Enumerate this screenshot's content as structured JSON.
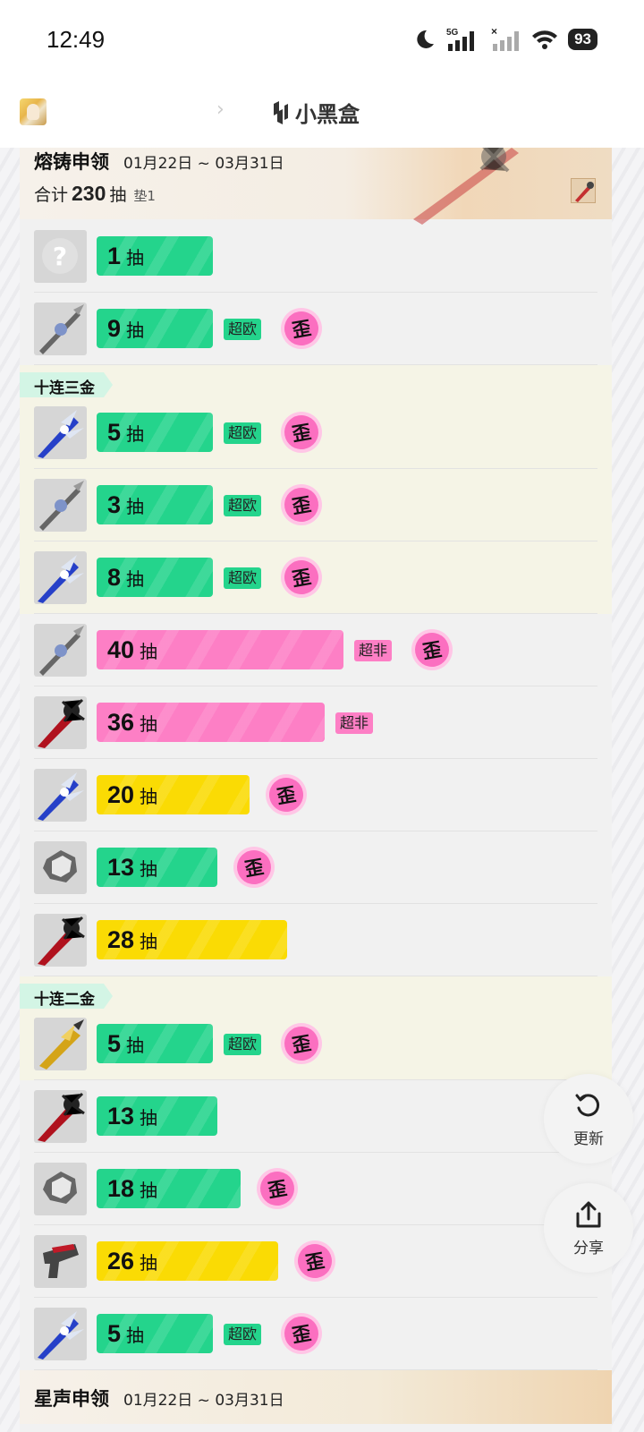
{
  "status_bar": {
    "time": "12:49",
    "battery": "93",
    "network": "5G"
  },
  "header": {
    "brand": "小黑盒"
  },
  "pool": {
    "title": "熔铸申领",
    "date_range": "01月22日 ~ 03月31日",
    "total_prefix": "合计",
    "total_value": "230",
    "total_unit": "抽",
    "pad": "垫1"
  },
  "unit": "抽",
  "badges": {
    "super_lucky": "超欧",
    "super_unlucky": "超非",
    "off_banner": "歪"
  },
  "groups": {
    "ten_three": "十连三金",
    "ten_two": "十连二金"
  },
  "rows": [
    {
      "pulls": "1",
      "color": "green",
      "badge": "",
      "off": false,
      "item": "unknown"
    },
    {
      "pulls": "9",
      "color": "green",
      "badge": "超欧",
      "off": true,
      "item": "silver-lance"
    },
    {
      "pulls": "5",
      "color": "green",
      "badge": "超欧",
      "off": true,
      "item": "blue-blade"
    },
    {
      "pulls": "3",
      "color": "green",
      "badge": "超欧",
      "off": true,
      "item": "silver-lance"
    },
    {
      "pulls": "8",
      "color": "green",
      "badge": "超欧",
      "off": true,
      "item": "blue-blade"
    },
    {
      "pulls": "40",
      "color": "pink",
      "badge": "超非",
      "off": true,
      "item": "silver-lance"
    },
    {
      "pulls": "36",
      "color": "pink",
      "badge": "超非",
      "off": false,
      "item": "red-sword"
    },
    {
      "pulls": "20",
      "color": "yellow",
      "badge": "",
      "off": true,
      "item": "blue-blade"
    },
    {
      "pulls": "13",
      "color": "green",
      "badge": "",
      "off": true,
      "item": "silver-gear"
    },
    {
      "pulls": "28",
      "color": "yellow",
      "badge": "",
      "off": false,
      "item": "red-sword"
    },
    {
      "pulls": "5",
      "color": "green",
      "badge": "超欧",
      "off": true,
      "item": "gold-blade"
    },
    {
      "pulls": "13",
      "color": "green",
      "badge": "",
      "off": false,
      "item": "red-sword"
    },
    {
      "pulls": "18",
      "color": "green",
      "badge": "",
      "off": true,
      "item": "silver-gear"
    },
    {
      "pulls": "26",
      "color": "yellow",
      "badge": "",
      "off": true,
      "item": "red-gun"
    },
    {
      "pulls": "5",
      "color": "green",
      "badge": "超欧",
      "off": true,
      "item": "blue-blade"
    }
  ],
  "next_pool": {
    "title": "星声申领",
    "date_range": "01月22日 ~ 03月31日"
  },
  "fab": {
    "refresh": "更新",
    "share": "分享"
  },
  "colors": {
    "green": "#24d48c",
    "pink": "#fd7fc5",
    "yellow": "#fadb04"
  }
}
